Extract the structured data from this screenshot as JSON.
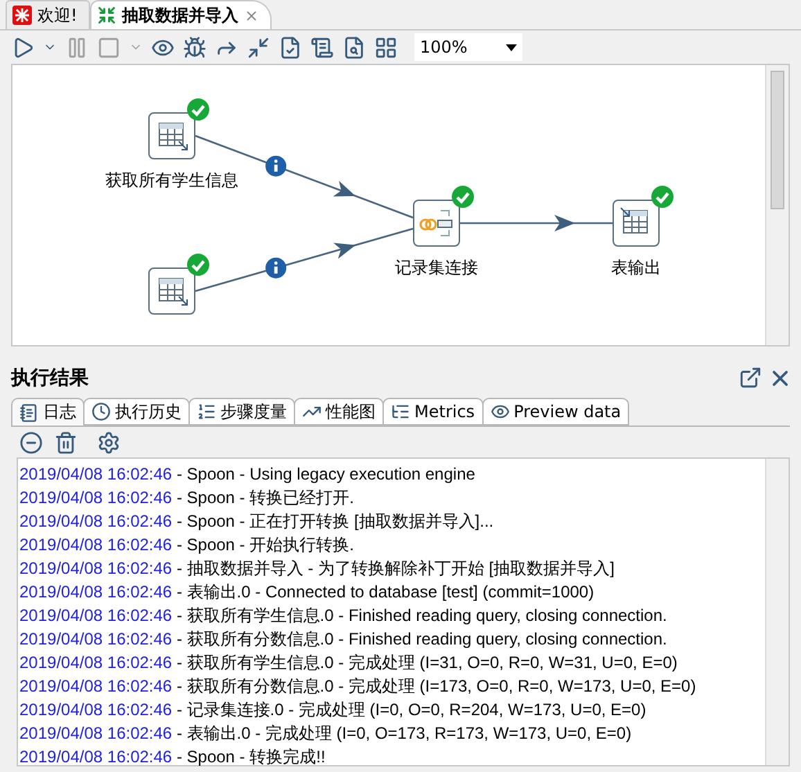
{
  "editor_tabs": [
    {
      "label": "欢迎!",
      "kind": "welcome",
      "selected": false,
      "closable": false
    },
    {
      "label": "抽取数据并导入",
      "kind": "transformation",
      "selected": true,
      "closable": true
    }
  ],
  "toolbar": {
    "buttons": [
      {
        "kind": "run",
        "disabled": false
      },
      {
        "kind": "dropdown",
        "disabled": false
      },
      {
        "kind": "pause",
        "disabled": true
      },
      {
        "kind": "stop",
        "disabled": true
      },
      {
        "kind": "dropdown",
        "disabled": true
      },
      {
        "kind": "preview",
        "disabled": false
      },
      {
        "kind": "debug",
        "disabled": false
      },
      {
        "kind": "replay",
        "disabled": false
      },
      {
        "kind": "verify",
        "disabled": false
      },
      {
        "kind": "impact",
        "disabled": false
      },
      {
        "kind": "sql",
        "disabled": false
      },
      {
        "kind": "explore",
        "disabled": false
      },
      {
        "kind": "grid",
        "disabled": false
      }
    ],
    "zoom": "100%"
  },
  "canvas": {
    "nodes": [
      {
        "label": "获取所有学生信息",
        "kind": "input",
        "ok": true
      },
      {
        "kind": "input",
        "ok": true
      },
      {
        "label": "记录集连接",
        "kind": "join",
        "ok": true
      },
      {
        "label": "表输出",
        "kind": "output",
        "ok": true
      }
    ],
    "hops": [
      {
        "info": true
      },
      {
        "info": true
      },
      {
        "info": false
      }
    ]
  },
  "results": {
    "title": "执行结果",
    "tabs": [
      {
        "label": "日志",
        "kind": "log",
        "selected": true
      },
      {
        "label": "执行历史",
        "kind": "history",
        "selected": false
      },
      {
        "label": "步骤度量",
        "kind": "steps",
        "selected": false
      },
      {
        "label": "性能图",
        "kind": "perf",
        "selected": false
      },
      {
        "label": "Metrics",
        "kind": "metrics",
        "selected": false
      },
      {
        "label": "Preview data",
        "kind": "preview",
        "selected": false
      }
    ],
    "log": [
      {
        "time": "2019/04/08 16:02:46",
        "text": " - Spoon - Using legacy execution engine"
      },
      {
        "time": "2019/04/08 16:02:46",
        "text": " - Spoon - 转换已经打开."
      },
      {
        "time": "2019/04/08 16:02:46",
        "text": " - Spoon - 正在打开转换 [抽取数据并导入]..."
      },
      {
        "time": "2019/04/08 16:02:46",
        "text": " - Spoon - 开始执行转换."
      },
      {
        "time": "2019/04/08 16:02:46",
        "text": " - 抽取数据并导入 - 为了转换解除补丁开始  [抽取数据并导入]"
      },
      {
        "time": "2019/04/08 16:02:46",
        "text": " - 表输出.0 - Connected to database [test] (commit=1000)"
      },
      {
        "time": "2019/04/08 16:02:46",
        "text": " - 获取所有学生信息.0 - Finished reading query, closing connection."
      },
      {
        "time": "2019/04/08 16:02:46",
        "text": " - 获取所有分数信息.0 - Finished reading query, closing connection."
      },
      {
        "time": "2019/04/08 16:02:46",
        "text": " - 获取所有学生信息.0 - 完成处理 (I=31, O=0, R=0, W=31, U=0, E=0)"
      },
      {
        "time": "2019/04/08 16:02:46",
        "text": " - 获取所有分数信息.0 - 完成处理 (I=173, O=0, R=0, W=173, U=0, E=0)"
      },
      {
        "time": "2019/04/08 16:02:46",
        "text": " - 记录集连接.0 - 完成处理 (I=0, O=0, R=204, W=173, U=0, E=0)"
      },
      {
        "time": "2019/04/08 16:02:46",
        "text": " - 表输出.0 - 完成处理 (I=0, O=173, R=173, W=173, U=0, E=0)"
      },
      {
        "time": "2019/04/08 16:02:46",
        "text": " - Spoon - 转换完成!!"
      }
    ]
  }
}
